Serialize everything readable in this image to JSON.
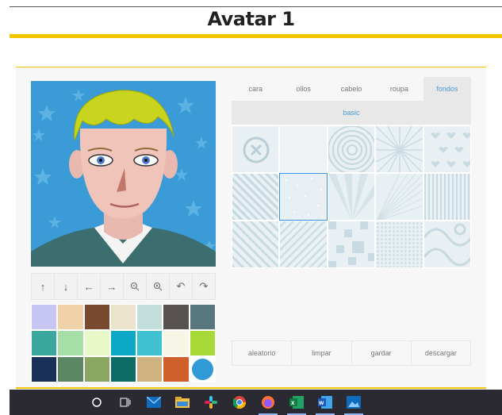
{
  "page": {
    "title": "Avatar 1"
  },
  "toolbar": {
    "icons": [
      "arrow-up-icon",
      "arrow-down-icon",
      "arrow-left-icon",
      "arrow-right-icon",
      "zoom-out-icon",
      "zoom-in-icon",
      "undo-icon",
      "redo-icon"
    ]
  },
  "palette": {
    "colors": [
      "#c7c6f2",
      "#f0d2a9",
      "#7a4a30",
      "#ece3cd",
      "#c2dedd",
      "#585250",
      "#58767e",
      "#3aa89e",
      "#a5dfa7",
      "#e8f8c7",
      "#0ea8c7",
      "#40c1d1",
      "#f7f5e6",
      "#a7d937",
      "#193158",
      "#5c8763",
      "#89a760",
      "#0d6d66",
      "#cfb482",
      "#cf5f2a",
      "#2f9ad6"
    ],
    "selected_index": 20
  },
  "tabs": [
    {
      "label": "cara",
      "active": false
    },
    {
      "label": "ollos",
      "active": false
    },
    {
      "label": "cabelo",
      "active": false
    },
    {
      "label": "roupa",
      "active": false
    },
    {
      "label": "fondos",
      "active": true
    }
  ],
  "subtab": {
    "label": "basic"
  },
  "backgrounds": {
    "tiles": [
      "none",
      "plain",
      "concentric-circles",
      "sunburst",
      "hearts",
      "diamonds",
      "dots",
      "rays",
      "rays-dense",
      "stripes",
      "diagonal-stripes",
      "diagonal-stripes-2",
      "pixels",
      "grid-dots",
      "swirls"
    ],
    "selected_index": 6
  },
  "actions": {
    "random": "aleatorio",
    "clear": "limpar",
    "save": "gardar",
    "download": "descargar"
  },
  "taskbar": {
    "icons": [
      "search-icon",
      "task-view-icon",
      "mail-icon",
      "file-explorer-icon",
      "slack-icon",
      "chrome-icon",
      "firefox-icon",
      "excel-icon",
      "word-icon",
      "photos-icon"
    ]
  }
}
